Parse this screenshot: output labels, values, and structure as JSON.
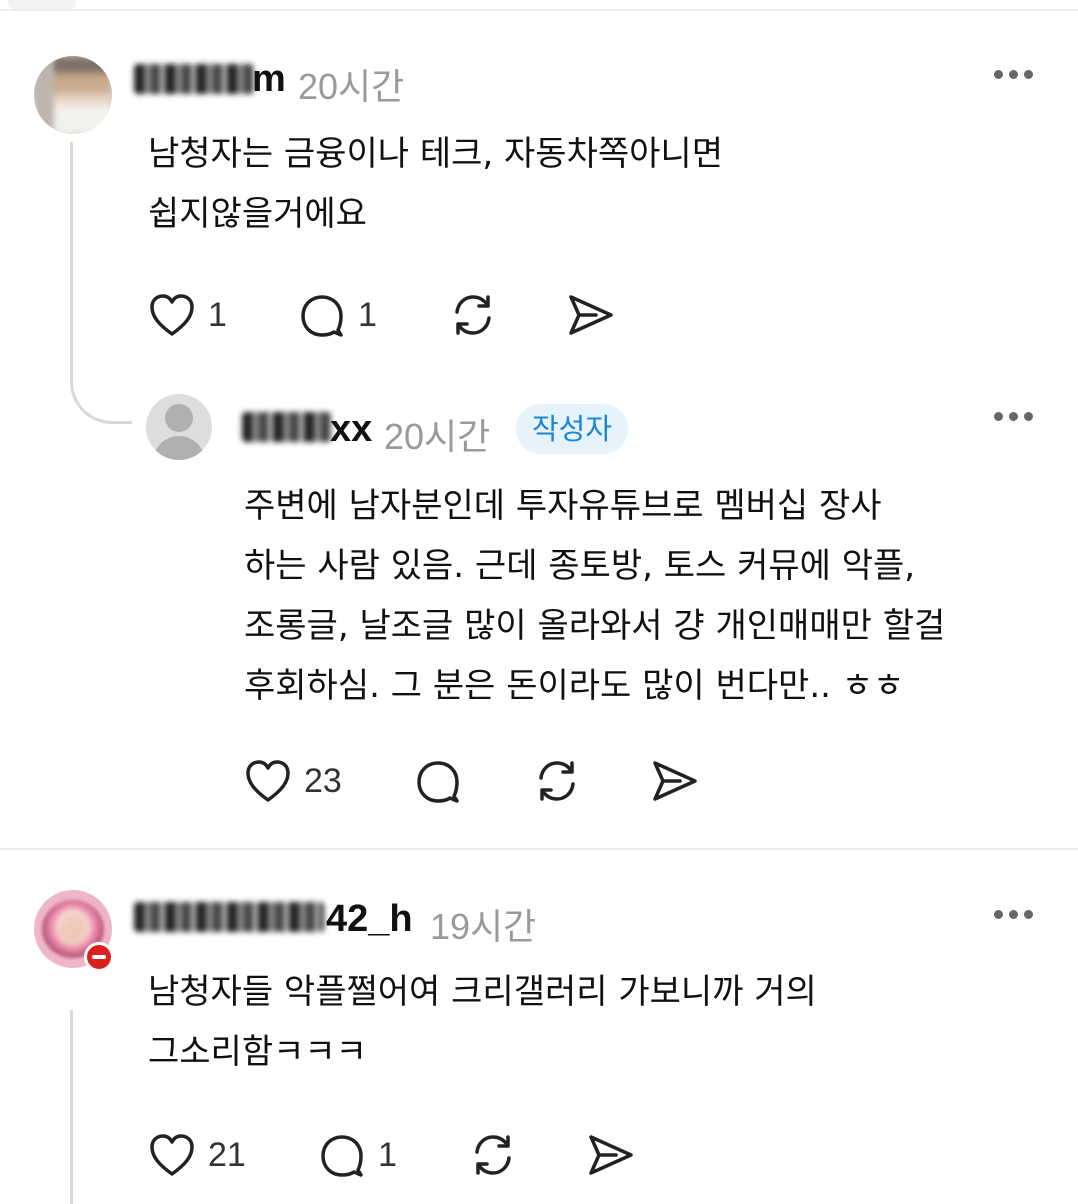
{
  "comments": [
    {
      "username_suffix": "m",
      "time": "20시간",
      "lines": [
        "남청자는 금융이나 테크, 자동차쪽아니면",
        "쉽지않을거에요"
      ],
      "like_count": "1",
      "reply_count": "1"
    },
    {
      "username_suffix": "xx",
      "time": "20시간",
      "author_badge": "작성자",
      "lines": [
        "주변에 남자분인데 투자유튜브로 멤버십 장사",
        "하는 사람 있음. 근데 종토방, 토스 커뮤에 악플,",
        "조롱글, 날조글 많이 올라와서 걍 개인매매만 할걸",
        "후회하심. 그 분은 돈이라도 많이 번다만.. ㅎㅎ"
      ],
      "like_count": "23"
    },
    {
      "username_suffix": "42_h",
      "time": "19시간",
      "lines": [
        "남청자들 악플쩔어여 크리갤러리 가보니까 거의",
        "그소리함ㅋㅋㅋ"
      ],
      "like_count": "21",
      "reply_count": "1"
    }
  ],
  "icons": {
    "like": "heart-icon",
    "reply": "comment-bubble-icon",
    "repost": "repost-icon",
    "share": "send-icon",
    "more": "more-horizontal-icon"
  },
  "colors": {
    "badge_bg": "#e7f3fc",
    "badge_text": "#1a86d8",
    "timestamp": "#9a9a9a",
    "divider": "#ececec"
  }
}
